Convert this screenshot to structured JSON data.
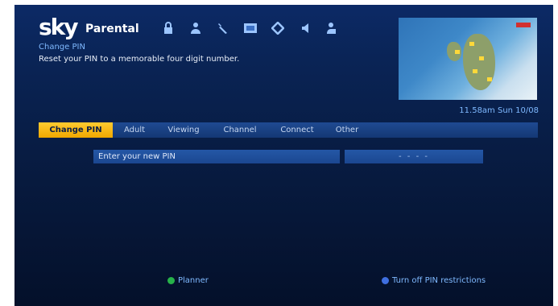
{
  "header": {
    "logo": "sky",
    "section_title": "Parental",
    "icons": [
      "lock-icon",
      "person-icon",
      "wrench-icon",
      "screen-icon",
      "tag-icon",
      "speaker-icon",
      "user-settings-icon"
    ]
  },
  "help": {
    "title": "Change PIN",
    "text": "Reset your PIN to a memorable four digit number."
  },
  "clock": "11.58am Sun 10/08",
  "tabs": [
    {
      "label": "Change PIN",
      "active": true
    },
    {
      "label": "Adult",
      "active": false
    },
    {
      "label": "Viewing",
      "active": false
    },
    {
      "label": "Channel",
      "active": false
    },
    {
      "label": "Connect",
      "active": false
    },
    {
      "label": "Other",
      "active": false
    }
  ],
  "form": {
    "label": "Enter your new PIN",
    "value": "- - - -"
  },
  "footer": {
    "green_label": "Planner",
    "blue_label": "Turn off PIN restrictions"
  },
  "colors": {
    "accent": "#ffc21a",
    "green": "#27b24a",
    "blue": "#3f6fe0"
  }
}
